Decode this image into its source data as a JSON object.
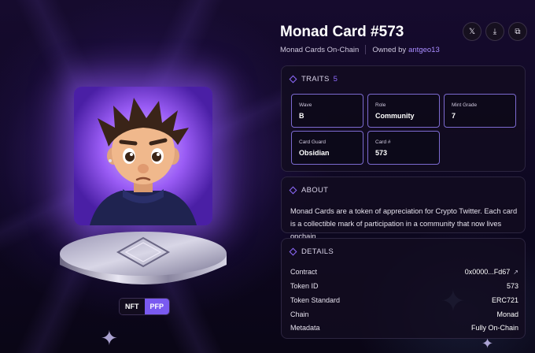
{
  "nft": {
    "title": "Monad Card #573",
    "collection": "Monad Cards On-Chain",
    "owned_by_label": "Owned by",
    "owner": "antgeo13"
  },
  "actions": [
    {
      "name": "x-icon",
      "glyph": "𝕏"
    },
    {
      "name": "download-icon",
      "glyph": "⤓"
    },
    {
      "name": "copy-icon",
      "glyph": "⧉"
    }
  ],
  "tags": {
    "nft": "NFT",
    "pfp": "PFP"
  },
  "traits": {
    "label": "TRAITS",
    "count": "5",
    "items": [
      {
        "key": "Wave",
        "value": "B"
      },
      {
        "key": "Role",
        "value": "Community"
      },
      {
        "key": "Mint Grade",
        "value": "7"
      },
      {
        "key": "Card Guard",
        "value": "Obsidian"
      },
      {
        "key": "Card #",
        "value": "573"
      }
    ]
  },
  "about": {
    "label": "ABOUT",
    "text": "Monad Cards are a token of appreciation for Crypto Twitter. Each card is a collectible mark of participation in a community that now lives onchain."
  },
  "details": {
    "label": "DETAILS",
    "rows": [
      {
        "key": "Contract",
        "value": "0x0000...Fd67"
      },
      {
        "key": "Token ID",
        "value": "573"
      },
      {
        "key": "Token Standard",
        "value": "ERC721"
      },
      {
        "key": "Chain",
        "value": "Monad"
      },
      {
        "key": "Metadata",
        "value": "Fully On-Chain"
      }
    ]
  },
  "colors": {
    "accent": "#8f6bff",
    "pfp_tag": "#7a5af0",
    "owner_link": "#a98cff"
  }
}
